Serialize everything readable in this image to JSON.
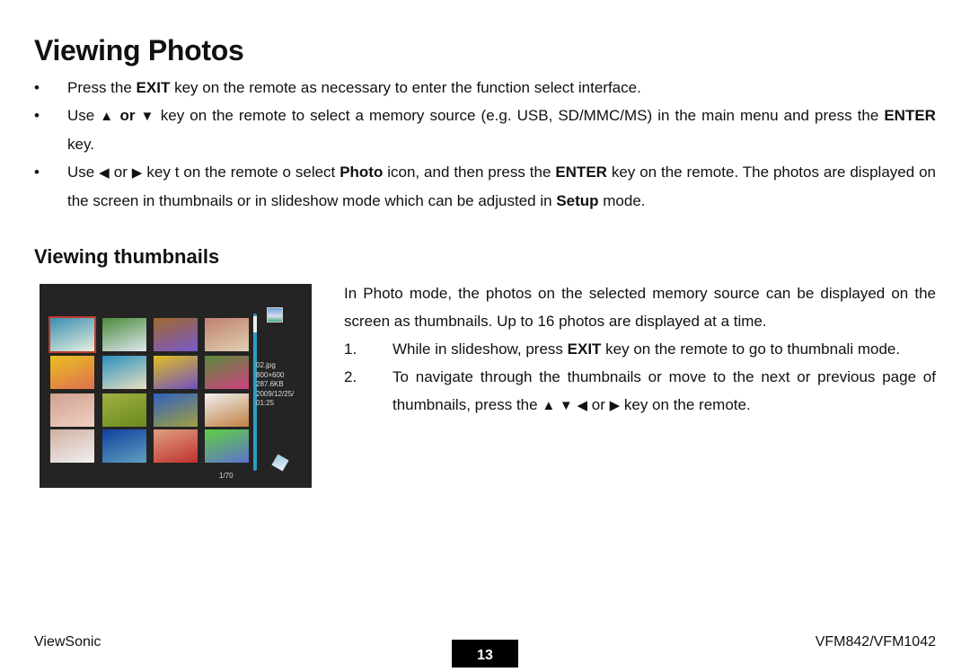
{
  "title": "Viewing Photos",
  "bullets": [
    [
      {
        "t": "Press the "
      },
      {
        "t": "EXIT",
        "b": true
      },
      {
        "t": " key on the remote as necessary to enter the function select interface."
      }
    ],
    [
      {
        "t": "Use "
      },
      {
        "t": "▲",
        "icon": "up-arrow-icon"
      },
      {
        "t": " or ",
        "b": true
      },
      {
        "t": "▼",
        "icon": "down-arrow-icon"
      },
      {
        "t": " key on the remote to select a memory source (e.g. USB, SD/MMC/MS) in the main menu and press the "
      },
      {
        "t": "ENTER",
        "b": true
      },
      {
        "t": " key."
      }
    ],
    [
      {
        "t": "Use "
      },
      {
        "t": "◀",
        "icon": "left-arrow-icon"
      },
      {
        "t": " or "
      },
      {
        "t": "▶",
        "icon": "right-arrow-icon"
      },
      {
        "t": " key t on the remote o select "
      },
      {
        "t": "Photo",
        "b": true
      },
      {
        "t": " icon, and then press the "
      },
      {
        "t": "ENTER",
        "b": true
      },
      {
        "t": " key on the remote. The photos are displayed on the screen in thumbnails or in slideshow mode which can be adjusted in "
      },
      {
        "t": "Setup",
        "b": true
      },
      {
        "t": " mode."
      }
    ]
  ],
  "bullet_char": "•",
  "subtitle": "Viewing thumbnails",
  "intro": "In Photo mode, the photos on the selected memory source can be displayed on the screen as thumbnails. Up to 16 photos are displayed at a time.",
  "steps": [
    {
      "n": "1.",
      "segs": [
        {
          "t": "While in slideshow, press "
        },
        {
          "t": "EXIT",
          "b": true
        },
        {
          "t": " key on the remote to go to thumbnali mode."
        }
      ]
    },
    {
      "n": "2.",
      "segs": [
        {
          "t": "To navigate through the thumbnails or move to the next or previous page of thumbnails, press the "
        },
        {
          "t": "▲",
          "icon": "up-arrow-icon"
        },
        {
          "t": " "
        },
        {
          "t": "▼",
          "icon": "down-arrow-icon"
        },
        {
          "t": " "
        },
        {
          "t": "◀",
          "icon": "left-arrow-icon"
        },
        {
          "t": " or "
        },
        {
          "t": "▶",
          "icon": "right-arrow-icon"
        },
        {
          "t": " key on the remote."
        }
      ]
    }
  ],
  "screen": {
    "info": [
      "02.jpg",
      "800×600",
      "287.6KB",
      "2009/12/25/",
      "01:25"
    ],
    "page_count": "1/70",
    "selected_index": 0,
    "thumb_colors": [
      [
        "#3a8fb0",
        "#e8f0e0"
      ],
      [
        "#4a8a3a",
        "#dfe8f0"
      ],
      [
        "#a0682a",
        "#7a5ad0"
      ],
      [
        "#c08070",
        "#e0d0b0"
      ],
      [
        "#e8c020",
        "#e07050"
      ],
      [
        "#2a90c0",
        "#e8e0c0"
      ],
      [
        "#e0c020",
        "#7050c0"
      ],
      [
        "#5a8a3a",
        "#d04080"
      ],
      [
        "#d0a090",
        "#f0d0c0"
      ],
      [
        "#a0b040",
        "#6a8a20"
      ],
      [
        "#3060c0",
        "#a0a040"
      ],
      [
        "#f0f0f0",
        "#c08040"
      ],
      [
        "#d0b0a0",
        "#f0f0f0"
      ],
      [
        "#1040a0",
        "#60a0c0"
      ],
      [
        "#e0a080",
        "#c03030"
      ],
      [
        "#60d040",
        "#6070d0"
      ]
    ]
  },
  "footer": {
    "brand": "ViewSonic",
    "page": "13",
    "model": "VFM842/VFM1042"
  }
}
